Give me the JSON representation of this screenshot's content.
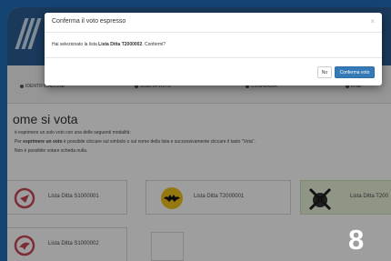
{
  "modal": {
    "title": "Conferma il voto espresso",
    "close_glyph": "×",
    "message_prefix": "Hai selezionato la lista ",
    "message_list": "Lista Ditta T2000002",
    "message_suffix": ". Confermi?",
    "no_label": "No",
    "confirm_label": "Conferma voto"
  },
  "steps": [
    "IDENTIFICAZIONE",
    "SCELTA VOTO",
    "CONFERMA",
    "FINE"
  ],
  "page": {
    "heading": "ome si vota",
    "line1": "è esprimere un solo voto con una delle seguenti modalità:",
    "line2_prefix": "Per ",
    "line2_bold": "esprimere un voto",
    "line2_rest": " è possibile cliccare sul simbolo o sul nome della lista e successivamente cliccare il tasto \"Vota\".",
    "line3": "Non è possibile votare scheda nulla."
  },
  "lists": [
    {
      "name": "Lista Ditta S1000001",
      "icon": "circular-emblem-icon",
      "color": "#c84a5a"
    },
    {
      "name": "Lista Ditta T2000001",
      "icon": "bat-emblem-icon",
      "color": "#e1b01a"
    },
    {
      "name": "Lista Ditta T200",
      "icon": "crossed-emblem-icon",
      "color": "#3f6f2e"
    },
    {
      "name": "Lista Ditta S1000002",
      "icon": "bird-emblem-icon",
      "color": "#c84a5a"
    }
  ],
  "overlay_number": "8"
}
